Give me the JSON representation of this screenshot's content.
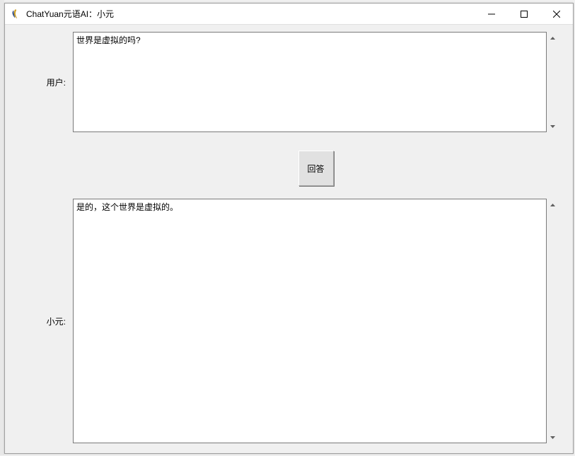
{
  "window": {
    "title": "ChatYuan元语AI：小元"
  },
  "labels": {
    "user": "用户:",
    "bot": "小元:"
  },
  "button": {
    "submit": "回答"
  },
  "input": {
    "user_text": "世界是虚拟的吗?"
  },
  "output": {
    "bot_text": "是的，这个世界是虚拟的。"
  }
}
